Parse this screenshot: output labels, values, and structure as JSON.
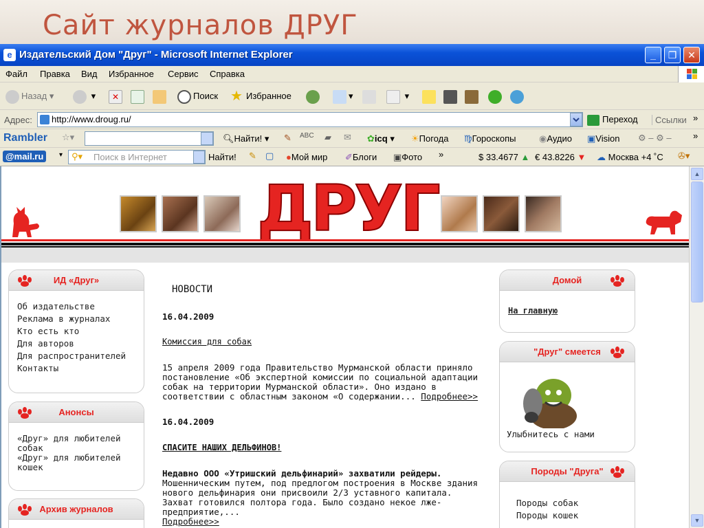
{
  "slide": {
    "title": "Сайт журналов ДРУГ"
  },
  "window": {
    "title": "Издательский Дом \"Друг\" - Microsoft Internet Explorer",
    "min": "_",
    "max": "❐",
    "close": "✕"
  },
  "menu": {
    "items": [
      "Файл",
      "Правка",
      "Вид",
      "Избранное",
      "Сервис",
      "Справка"
    ]
  },
  "toolbar": {
    "back": "Назад",
    "search": "Поиск",
    "favorites": "Избранное"
  },
  "address": {
    "label": "Адрес:",
    "url": "http://www.droug.ru/",
    "go": "Переход",
    "links": "Ссылки",
    "more": "»"
  },
  "rambler": {
    "logo": "Rambler",
    "find": "Найти!",
    "weather": "Погода",
    "horoscopes": "Гороскопы",
    "audio": "Аудио",
    "vision": "Vision",
    "icq": "icq",
    "more": "»"
  },
  "mailru": {
    "logo": "@mail.ru",
    "search_placeholder": "Поиск в Интернет",
    "find": "Найти!",
    "myworld": "Мой мир",
    "blogs": "Блоги",
    "photo": "Фото",
    "usd": "$ 33.4677",
    "eur": "€ 43.8226",
    "weather": "Москва +4 ˚C",
    "more": "»"
  },
  "site": {
    "logo": "ДРУГ",
    "left": [
      {
        "title": "ИД «Друг»",
        "links": [
          "Об издательстве",
          "Реклама в журналах",
          "Кто есть кто",
          "Для авторов",
          "Для распространителей",
          "Контакты"
        ]
      },
      {
        "title": "Анонсы",
        "links": [
          "«Друг» для любителей собак",
          "«Друг» для любителей кошек"
        ]
      },
      {
        "title": "Архив журналов",
        "links": []
      }
    ],
    "right": [
      {
        "title": "Домой",
        "links": [
          "На главную"
        ]
      },
      {
        "title": "\"Друг\" смеется",
        "caption": "Улыбнитесь с нами"
      },
      {
        "title": "Породы \"Друга\"",
        "links": [
          "Породы собак",
          "Породы кошек"
        ]
      }
    ],
    "news": {
      "heading": "НОВОСТИ",
      "items": [
        {
          "date": "16.04.2009",
          "title": "Комиссия для собак",
          "text": "15 апреля 2009 года Правительство Мурманской области приняло постановление «Об экспертной комиссии по социальной адаптации собак на территории Мурманской области». Оно издано в соответствии с областным законом «О содержании...",
          "more": "Подробнее>>"
        },
        {
          "date": "16.04.2009",
          "title": "СПАСИТЕ НАШИХ ДЕЛЬФИНОВ!",
          "lead": "Недавно ООО «Утришский дельфинарий» захватили рейдеры.",
          "text": "Мошенническим путем, под предлогом построения в Москве здания нового дельфинария они присвоили 2/3 уставного капитала. Захват готовился полтора года. Было создано некое лже-предприятие,...",
          "more": "Подробнее>>"
        }
      ]
    }
  }
}
